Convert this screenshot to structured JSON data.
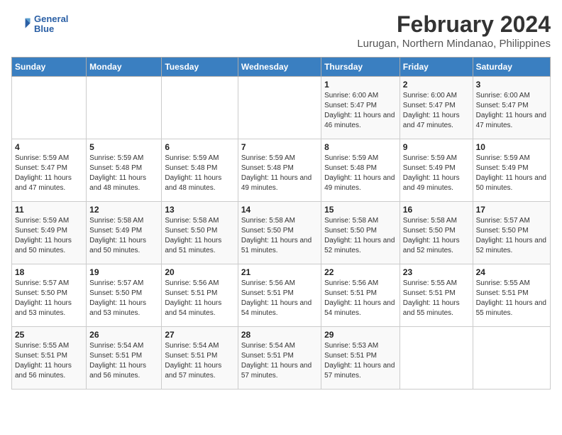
{
  "logo": {
    "line1": "General",
    "line2": "Blue"
  },
  "title": "February 2024",
  "subtitle": "Lurugan, Northern Mindanao, Philippines",
  "headers": [
    "Sunday",
    "Monday",
    "Tuesday",
    "Wednesday",
    "Thursday",
    "Friday",
    "Saturday"
  ],
  "weeks": [
    [
      {
        "day": "",
        "sunrise": "",
        "sunset": "",
        "daylight": ""
      },
      {
        "day": "",
        "sunrise": "",
        "sunset": "",
        "daylight": ""
      },
      {
        "day": "",
        "sunrise": "",
        "sunset": "",
        "daylight": ""
      },
      {
        "day": "",
        "sunrise": "",
        "sunset": "",
        "daylight": ""
      },
      {
        "day": "1",
        "sunrise": "Sunrise: 6:00 AM",
        "sunset": "Sunset: 5:47 PM",
        "daylight": "Daylight: 11 hours and 46 minutes."
      },
      {
        "day": "2",
        "sunrise": "Sunrise: 6:00 AM",
        "sunset": "Sunset: 5:47 PM",
        "daylight": "Daylight: 11 hours and 47 minutes."
      },
      {
        "day": "3",
        "sunrise": "Sunrise: 6:00 AM",
        "sunset": "Sunset: 5:47 PM",
        "daylight": "Daylight: 11 hours and 47 minutes."
      }
    ],
    [
      {
        "day": "4",
        "sunrise": "Sunrise: 5:59 AM",
        "sunset": "Sunset: 5:47 PM",
        "daylight": "Daylight: 11 hours and 47 minutes."
      },
      {
        "day": "5",
        "sunrise": "Sunrise: 5:59 AM",
        "sunset": "Sunset: 5:48 PM",
        "daylight": "Daylight: 11 hours and 48 minutes."
      },
      {
        "day": "6",
        "sunrise": "Sunrise: 5:59 AM",
        "sunset": "Sunset: 5:48 PM",
        "daylight": "Daylight: 11 hours and 48 minutes."
      },
      {
        "day": "7",
        "sunrise": "Sunrise: 5:59 AM",
        "sunset": "Sunset: 5:48 PM",
        "daylight": "Daylight: 11 hours and 49 minutes."
      },
      {
        "day": "8",
        "sunrise": "Sunrise: 5:59 AM",
        "sunset": "Sunset: 5:48 PM",
        "daylight": "Daylight: 11 hours and 49 minutes."
      },
      {
        "day": "9",
        "sunrise": "Sunrise: 5:59 AM",
        "sunset": "Sunset: 5:49 PM",
        "daylight": "Daylight: 11 hours and 49 minutes."
      },
      {
        "day": "10",
        "sunrise": "Sunrise: 5:59 AM",
        "sunset": "Sunset: 5:49 PM",
        "daylight": "Daylight: 11 hours and 50 minutes."
      }
    ],
    [
      {
        "day": "11",
        "sunrise": "Sunrise: 5:59 AM",
        "sunset": "Sunset: 5:49 PM",
        "daylight": "Daylight: 11 hours and 50 minutes."
      },
      {
        "day": "12",
        "sunrise": "Sunrise: 5:58 AM",
        "sunset": "Sunset: 5:49 PM",
        "daylight": "Daylight: 11 hours and 50 minutes."
      },
      {
        "day": "13",
        "sunrise": "Sunrise: 5:58 AM",
        "sunset": "Sunset: 5:50 PM",
        "daylight": "Daylight: 11 hours and 51 minutes."
      },
      {
        "day": "14",
        "sunrise": "Sunrise: 5:58 AM",
        "sunset": "Sunset: 5:50 PM",
        "daylight": "Daylight: 11 hours and 51 minutes."
      },
      {
        "day": "15",
        "sunrise": "Sunrise: 5:58 AM",
        "sunset": "Sunset: 5:50 PM",
        "daylight": "Daylight: 11 hours and 52 minutes."
      },
      {
        "day": "16",
        "sunrise": "Sunrise: 5:58 AM",
        "sunset": "Sunset: 5:50 PM",
        "daylight": "Daylight: 11 hours and 52 minutes."
      },
      {
        "day": "17",
        "sunrise": "Sunrise: 5:57 AM",
        "sunset": "Sunset: 5:50 PM",
        "daylight": "Daylight: 11 hours and 52 minutes."
      }
    ],
    [
      {
        "day": "18",
        "sunrise": "Sunrise: 5:57 AM",
        "sunset": "Sunset: 5:50 PM",
        "daylight": "Daylight: 11 hours and 53 minutes."
      },
      {
        "day": "19",
        "sunrise": "Sunrise: 5:57 AM",
        "sunset": "Sunset: 5:50 PM",
        "daylight": "Daylight: 11 hours and 53 minutes."
      },
      {
        "day": "20",
        "sunrise": "Sunrise: 5:56 AM",
        "sunset": "Sunset: 5:51 PM",
        "daylight": "Daylight: 11 hours and 54 minutes."
      },
      {
        "day": "21",
        "sunrise": "Sunrise: 5:56 AM",
        "sunset": "Sunset: 5:51 PM",
        "daylight": "Daylight: 11 hours and 54 minutes."
      },
      {
        "day": "22",
        "sunrise": "Sunrise: 5:56 AM",
        "sunset": "Sunset: 5:51 PM",
        "daylight": "Daylight: 11 hours and 54 minutes."
      },
      {
        "day": "23",
        "sunrise": "Sunrise: 5:55 AM",
        "sunset": "Sunset: 5:51 PM",
        "daylight": "Daylight: 11 hours and 55 minutes."
      },
      {
        "day": "24",
        "sunrise": "Sunrise: 5:55 AM",
        "sunset": "Sunset: 5:51 PM",
        "daylight": "Daylight: 11 hours and 55 minutes."
      }
    ],
    [
      {
        "day": "25",
        "sunrise": "Sunrise: 5:55 AM",
        "sunset": "Sunset: 5:51 PM",
        "daylight": "Daylight: 11 hours and 56 minutes."
      },
      {
        "day": "26",
        "sunrise": "Sunrise: 5:54 AM",
        "sunset": "Sunset: 5:51 PM",
        "daylight": "Daylight: 11 hours and 56 minutes."
      },
      {
        "day": "27",
        "sunrise": "Sunrise: 5:54 AM",
        "sunset": "Sunset: 5:51 PM",
        "daylight": "Daylight: 11 hours and 57 minutes."
      },
      {
        "day": "28",
        "sunrise": "Sunrise: 5:54 AM",
        "sunset": "Sunset: 5:51 PM",
        "daylight": "Daylight: 11 hours and 57 minutes."
      },
      {
        "day": "29",
        "sunrise": "Sunrise: 5:53 AM",
        "sunset": "Sunset: 5:51 PM",
        "daylight": "Daylight: 11 hours and 57 minutes."
      },
      {
        "day": "",
        "sunrise": "",
        "sunset": "",
        "daylight": ""
      },
      {
        "day": "",
        "sunrise": "",
        "sunset": "",
        "daylight": ""
      }
    ]
  ]
}
